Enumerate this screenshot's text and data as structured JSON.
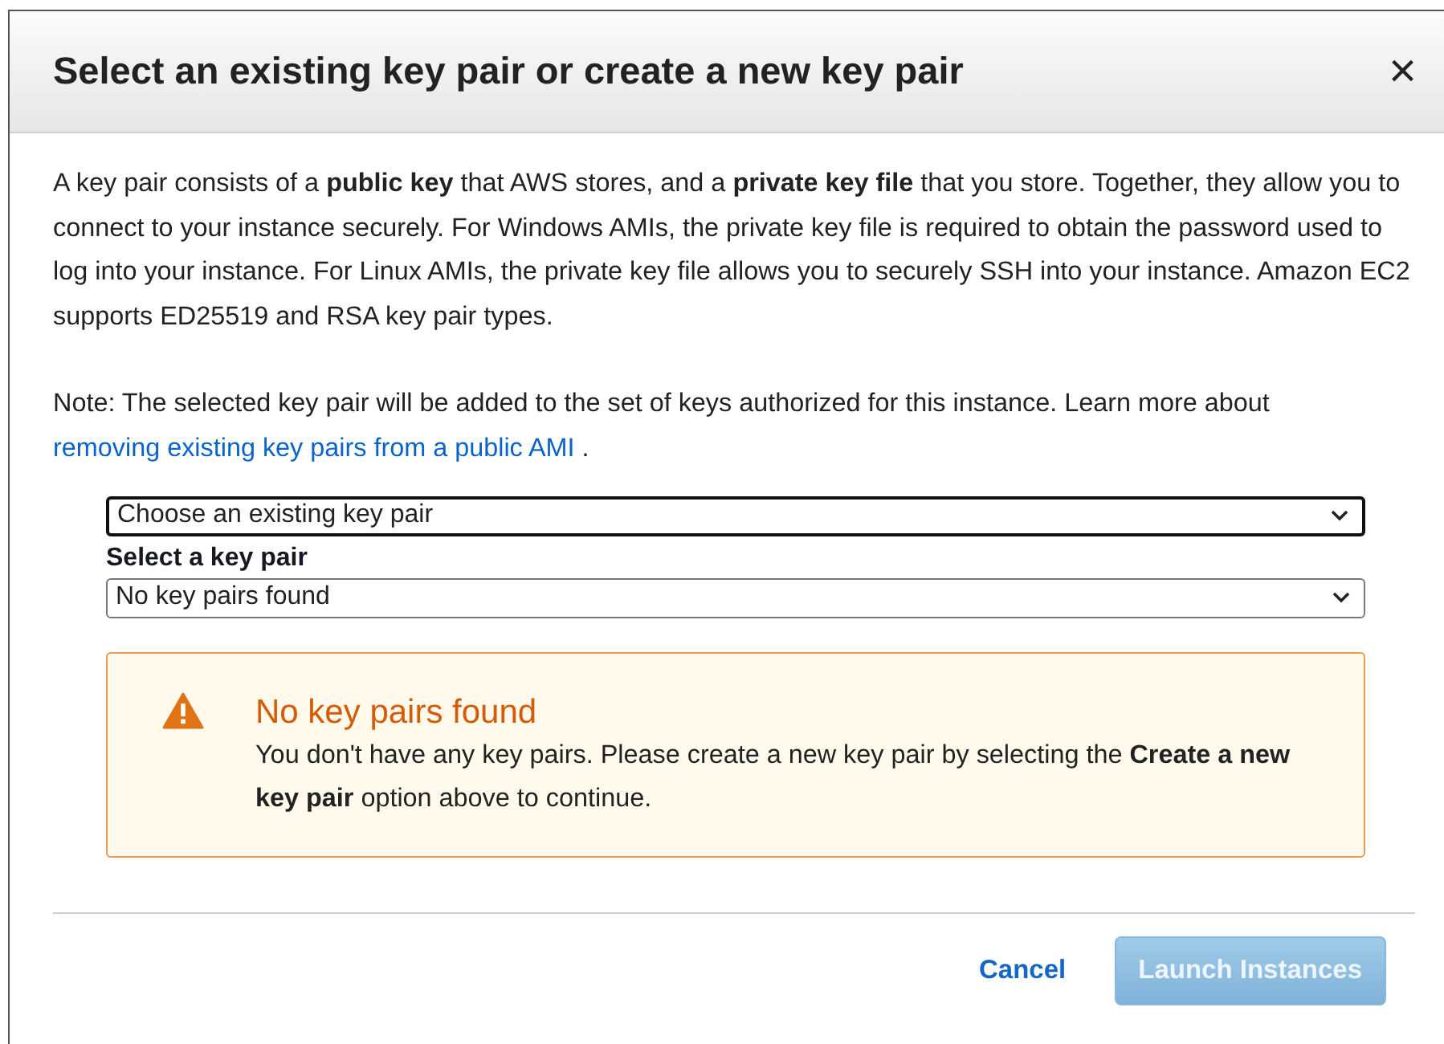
{
  "dialog": {
    "title": "Select an existing key pair or create a new key pair",
    "close": "×"
  },
  "description": "A key pair consists of a **public key** that AWS stores, and a **private key file** that you store. Together, they allow you to connect to your instance securely. For Windows AMIs, the private key file is required to obtain the password used to log into your instance. For Linux AMIs, the private key file allows you to securely SSH into your instance. Amazon EC2 supports ED25519 and RSA key pair types.",
  "note": {
    "text": "Note: The selected key pair will be added to the set of keys authorized for this instance. Learn more about ",
    "link": "removing existing key pairs from a public AMI",
    "end": "."
  },
  "mode_select": {
    "value": "Choose an existing key pair",
    "focused": true
  },
  "key_select": {
    "label": "Select a key pair",
    "value": "No key pairs found",
    "focused": false
  },
  "alert": {
    "title": "No key pairs found",
    "message": "You don't have any key pairs. Please create a new key pair by selecting the **Create a new key pair** option above to continue."
  },
  "buttons": [
    {
      "label": "Cancel",
      "kind": "link",
      "disabled": false
    },
    {
      "label": "Launch Instances",
      "kind": "primary",
      "disabled": true
    }
  ]
}
